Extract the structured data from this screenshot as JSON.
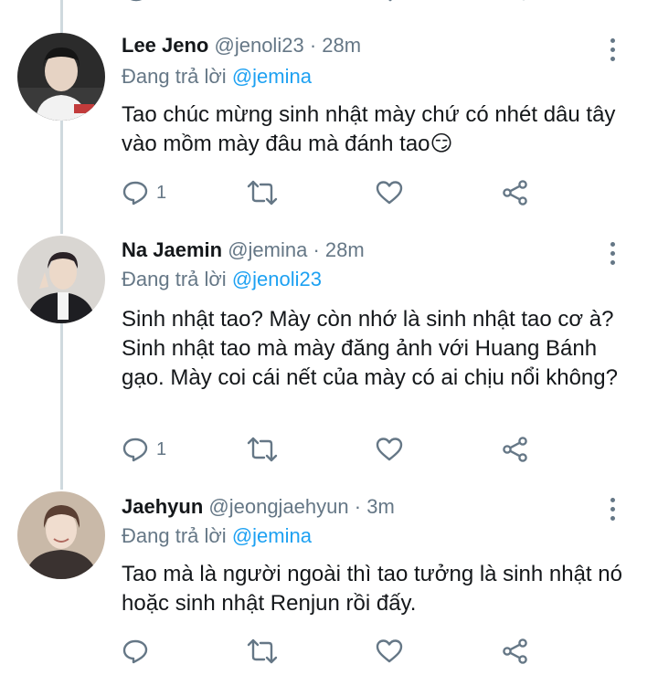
{
  "tweets": [
    {
      "name": "Lee Jeno",
      "handle": "@jenoli23",
      "time": "28m",
      "reply_prefix": "Đang trả lời",
      "reply_to": "@jemina",
      "text": "Tao chúc mừng sinh nhật mày chứ có nhét dâu tây vào mồm mày đâu mà đánh tao😏",
      "reply_count": "1",
      "avatar_colors": [
        "#2b2b2b",
        "#e8e8e8"
      ]
    },
    {
      "name": "Na Jaemin",
      "handle": "@jemina",
      "time": "28m",
      "reply_prefix": "Đang trả lời",
      "reply_to": "@jenoli23",
      "text": "Sinh nhật tao? Mày còn nhớ là sinh nhật tao cơ à? Sinh nhật tao mà mày đăng ảnh với Huang Bánh gạo. Mày coi cái nết của mày có ai chịu nổi không?",
      "reply_count": "1",
      "avatar_colors": [
        "#1e1e22",
        "#d9d6d2"
      ]
    },
    {
      "name": "Jaehyun",
      "handle": "@jeongjaehyun",
      "time": "3m",
      "reply_prefix": "Đang trả lời",
      "reply_to": "@jemina",
      "text": "Tao mà là người ngoài thì tao tưởng là sinh nhật nó hoặc sinh nhật Renjun rồi đấy.",
      "reply_count": "",
      "avatar_colors": [
        "#c9b9a8",
        "#3a3230"
      ]
    }
  ],
  "icons": {
    "reply": "reply-icon",
    "retweet": "retweet-icon",
    "like": "like-icon",
    "share": "share-icon",
    "more": "more-vertical-icon"
  },
  "colors": {
    "text": "#14171a",
    "secondary": "#657786",
    "link": "#1da1f2",
    "thread_line": "#cfd9de"
  }
}
